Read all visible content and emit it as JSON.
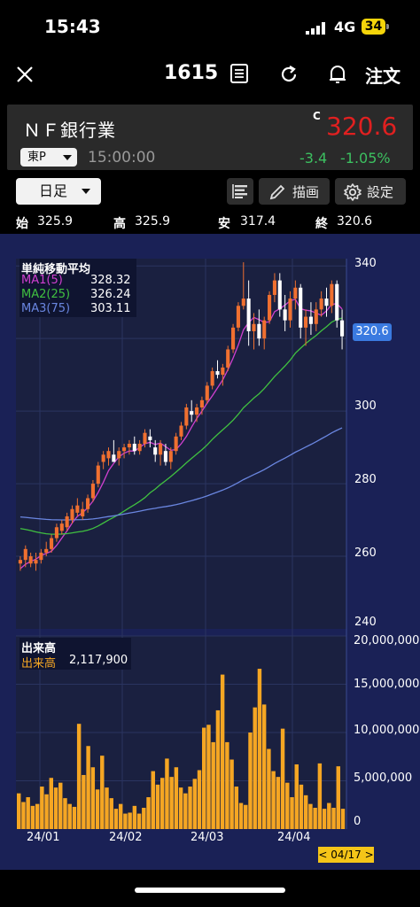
{
  "status": {
    "time": "15:43",
    "network": "4G",
    "battery": "34"
  },
  "nav": {
    "title": "1615",
    "order_label": "注文",
    "close_icon": "close-icon",
    "doc_icon": "document-icon",
    "refresh_icon": "refresh-icon",
    "bell_icon": "bell-icon"
  },
  "quote": {
    "name": "ＮＦ銀行業",
    "market": "東P",
    "time": "15:00:00",
    "marker": "C",
    "price": "320.6",
    "change": "-3.4",
    "change_pct": "-1.05%",
    "colors": {
      "price": "#e02020",
      "change": "#3cc060"
    }
  },
  "toolbar": {
    "period": "日足",
    "draw_label": "描画",
    "settings_label": "設定"
  },
  "ohlc": {
    "open_label": "始",
    "open": "325.9",
    "high_label": "高",
    "high": "325.9",
    "low_label": "安",
    "low": "317.4",
    "close_label": "終",
    "close": "320.6"
  },
  "ma_legend": {
    "title": "単純移動平均",
    "items": [
      {
        "label": "MA1(5)",
        "value": "328.32"
      },
      {
        "label": "MA2(25)",
        "value": "326.24"
      },
      {
        "label": "MA3(75)",
        "value": "303.11"
      }
    ]
  },
  "volume_legend": {
    "title": "出来高",
    "label": "出来高",
    "value": "2,117,900"
  },
  "price_axis": {
    "ticks": [
      "340",
      "320.6",
      "300",
      "280",
      "260",
      "240"
    ]
  },
  "volume_axis": {
    "ticks": [
      "20,000,000",
      "15,000,000",
      "10,000,000",
      "5,000,000",
      "0"
    ]
  },
  "x_axis": {
    "ticks": [
      "24/01",
      "24/02",
      "24/03",
      "24/04"
    ],
    "cursor": "< 04/17 >"
  },
  "chart_data": [
    {
      "type": "candlestick",
      "ylim": [
        240,
        342
      ],
      "candles": [
        [
          258,
          260,
          256,
          259
        ],
        [
          259,
          263,
          257,
          262
        ],
        [
          258,
          261,
          257,
          260
        ],
        [
          258,
          261,
          256,
          259
        ],
        [
          259,
          262,
          258,
          261
        ],
        [
          261,
          264,
          260,
          262
        ],
        [
          262,
          266,
          261,
          265
        ],
        [
          265,
          269,
          264,
          268
        ],
        [
          267,
          270,
          266,
          269
        ],
        [
          268,
          272,
          267,
          271
        ],
        [
          270,
          274,
          269,
          273
        ],
        [
          272,
          276,
          271,
          274
        ],
        [
          271,
          275,
          270,
          273
        ],
        [
          273,
          277,
          272,
          276
        ],
        [
          276,
          281,
          275,
          280
        ],
        [
          280,
          286,
          279,
          285
        ],
        [
          286,
          289,
          284,
          288
        ],
        [
          287,
          290,
          285,
          289
        ],
        [
          288,
          292,
          286,
          286
        ],
        [
          287,
          290,
          285,
          289
        ],
        [
          289,
          291,
          287,
          290
        ],
        [
          290,
          292,
          288,
          291
        ],
        [
          291,
          293,
          288,
          289
        ],
        [
          289,
          292,
          288,
          291
        ],
        [
          291,
          295,
          290,
          294
        ],
        [
          293,
          295,
          290,
          292
        ],
        [
          290,
          292,
          286,
          288
        ],
        [
          288,
          292,
          285,
          291
        ],
        [
          289,
          291,
          285,
          286
        ],
        [
          286,
          290,
          284,
          289
        ],
        [
          289,
          294,
          288,
          293
        ],
        [
          293,
          297,
          292,
          296
        ],
        [
          296,
          302,
          295,
          301
        ],
        [
          300,
          303,
          297,
          299
        ],
        [
          299,
          302,
          297,
          301
        ],
        [
          301,
          304,
          299,
          303
        ],
        [
          303,
          308,
          302,
          307
        ],
        [
          307,
          312,
          306,
          311
        ],
        [
          311,
          314,
          309,
          310
        ],
        [
          310,
          313,
          307,
          312
        ],
        [
          312,
          318,
          311,
          317
        ],
        [
          317,
          324,
          316,
          323
        ],
        [
          323,
          330,
          322,
          329
        ],
        [
          329,
          341,
          328,
          331
        ],
        [
          331,
          336,
          318,
          322
        ],
        [
          322,
          327,
          317,
          324
        ],
        [
          324,
          328,
          318,
          320
        ],
        [
          320,
          326,
          317,
          325
        ],
        [
          325,
          333,
          324,
          332
        ],
        [
          332,
          338,
          330,
          336
        ],
        [
          336,
          338,
          326,
          328
        ],
        [
          328,
          332,
          322,
          325
        ],
        [
          325,
          333,
          323,
          331
        ],
        [
          331,
          336,
          328,
          334
        ],
        [
          334,
          335,
          320,
          323
        ],
        [
          323,
          328,
          318,
          326
        ],
        [
          326,
          330,
          321,
          324
        ],
        [
          324,
          330,
          322,
          328
        ],
        [
          328,
          333,
          326,
          331
        ],
        [
          331,
          334,
          326,
          329
        ],
        [
          329,
          336,
          327,
          335
        ],
        [
          335,
          336,
          323,
          325
        ],
        [
          325,
          328,
          317,
          320.6
        ]
      ]
    },
    {
      "type": "bar",
      "series": [
        {
          "name": "出来高",
          "values": [
            3.7,
            2.8,
            3.3,
            2.4,
            2.6,
            4.4,
            3.6,
            5.3,
            4.3,
            4.8,
            3.2,
            2.6,
            2.3,
            10.9,
            5.6,
            8.6,
            6.4,
            4.1,
            7.6,
            4.3,
            3.2,
            2.1,
            2.6,
            1.6,
            1.7,
            2.4,
            1.6,
            2.2,
            3.3,
            6.0,
            4.6,
            5.3,
            7.3,
            5.4,
            6.4,
            4.3,
            3.7,
            4.4,
            5.2,
            6.1,
            10.5,
            10.8,
            9.0,
            12.3,
            16.0,
            9.0,
            7.2,
            4.4,
            2.7,
            2.5,
            10.0,
            12.6,
            16.6,
            12.9,
            8.3,
            6.0,
            5.4,
            10.4,
            4.8,
            3.3,
            6.7,
            4.6,
            3.5,
            2.6,
            2.2,
            6.8,
            2.1,
            2.7,
            2.2,
            6.5,
            2.1
          ]
        }
      ],
      "ylim": [
        0,
        20000000
      ],
      "unit_scale": 1000000
    }
  ]
}
